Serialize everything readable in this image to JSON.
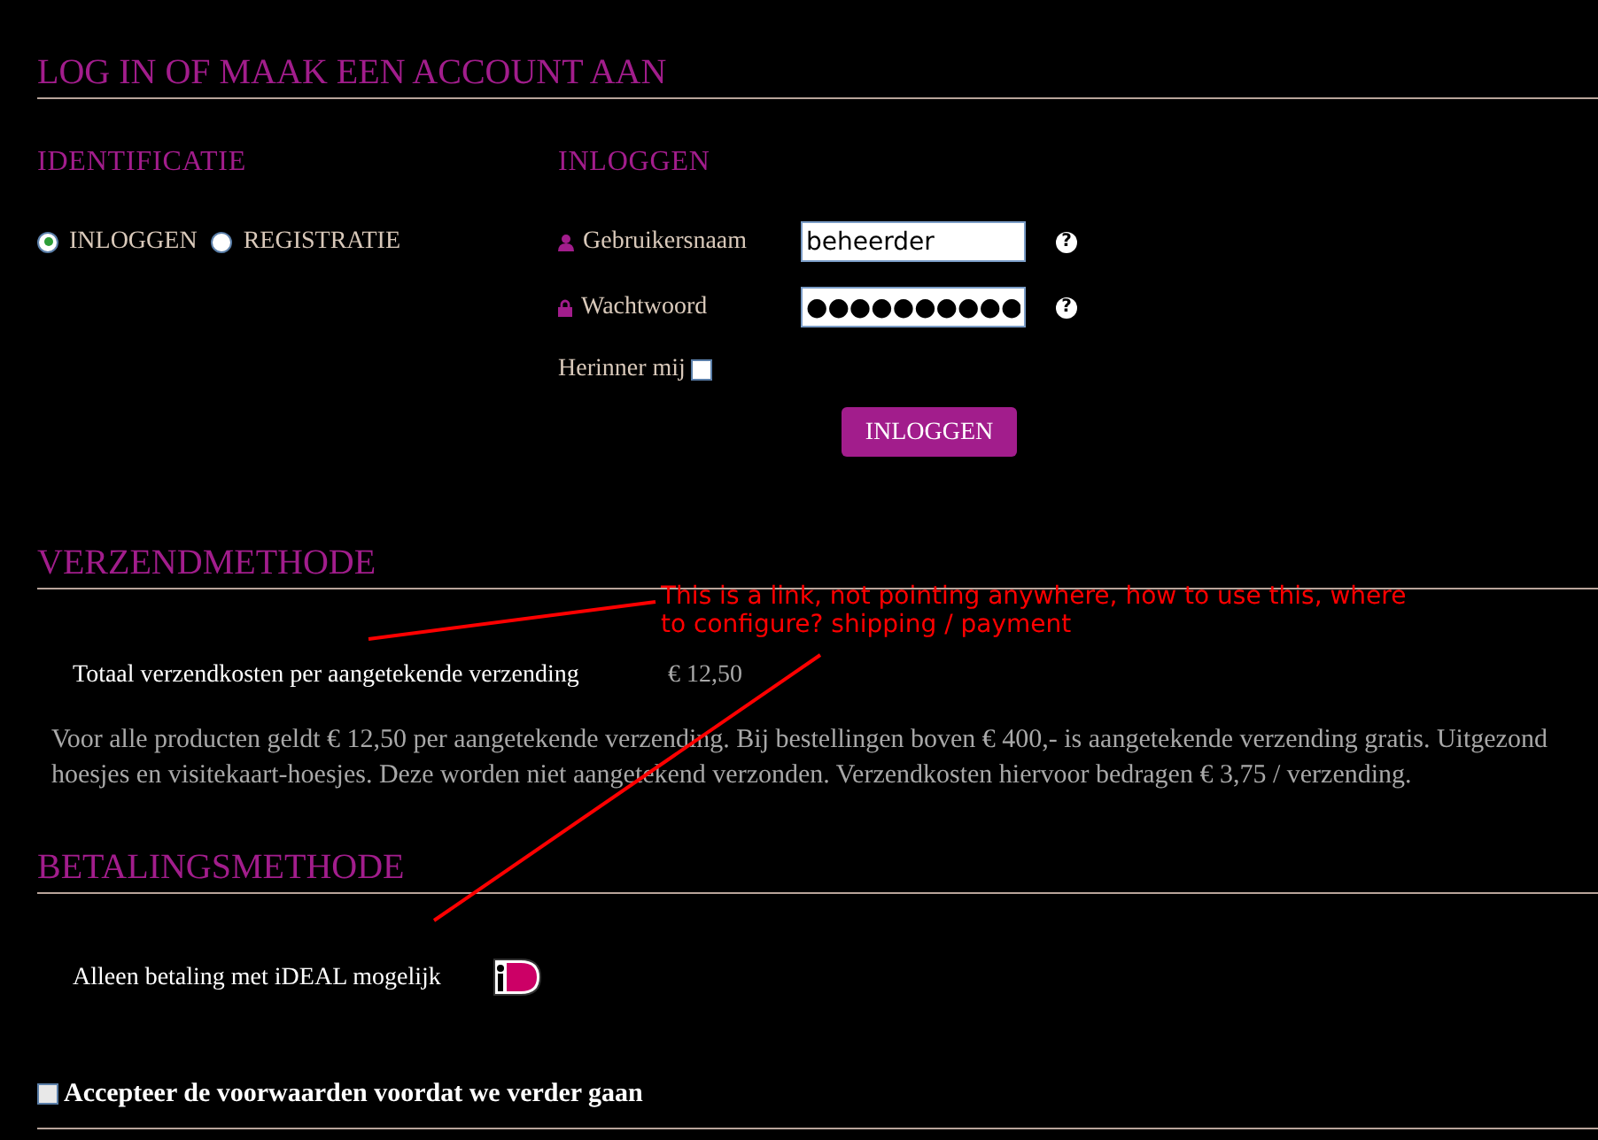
{
  "title": "LOG IN OF MAAK EEN ACCOUNT AAN",
  "identification": {
    "heading": "IDENTIFICATIE",
    "options": [
      {
        "label": "INLOGGEN",
        "selected": true
      },
      {
        "label": "REGISTRATIE",
        "selected": false
      }
    ]
  },
  "login": {
    "heading": "INLOGGEN",
    "fields": [
      {
        "kind": "user",
        "label": "Gebruikersnaam",
        "value": "beheerder",
        "help": "?"
      },
      {
        "kind": "password",
        "label": "Wachtwoord",
        "value": "●●●●●●●●●●",
        "help": "?"
      }
    ],
    "remember": {
      "label": "Herinner mij",
      "checked": false
    },
    "button": "INLOGGEN"
  },
  "shipping": {
    "heading": "VERZENDMETHODE",
    "label": "Totaal verzendkosten per aangetekende verzending",
    "price": "€ 12,50",
    "note_lines": [
      "Voor alle producten geldt € 12,50 per aangetekende verzending. Bij bestellingen boven € 400,- is aangetekende verzending gratis. Uitgezond",
      "hoesjes en visitekaart-hoesjes. Deze worden niet aangetekend verzonden. Verzendkosten hiervoor bedragen € 3,75 / verzending."
    ]
  },
  "payment": {
    "heading": "BETALINGSMETHODE",
    "label": "Alleen betaling met iDEAL mogelijk"
  },
  "terms": {
    "label": "Accepteer de voorwaarden voordat we verder gaan",
    "checked": false
  },
  "annotation": {
    "lines": [
      "This is a link, not pointing anywhere, how to use this, where",
      "to configure? shipping / payment"
    ]
  }
}
